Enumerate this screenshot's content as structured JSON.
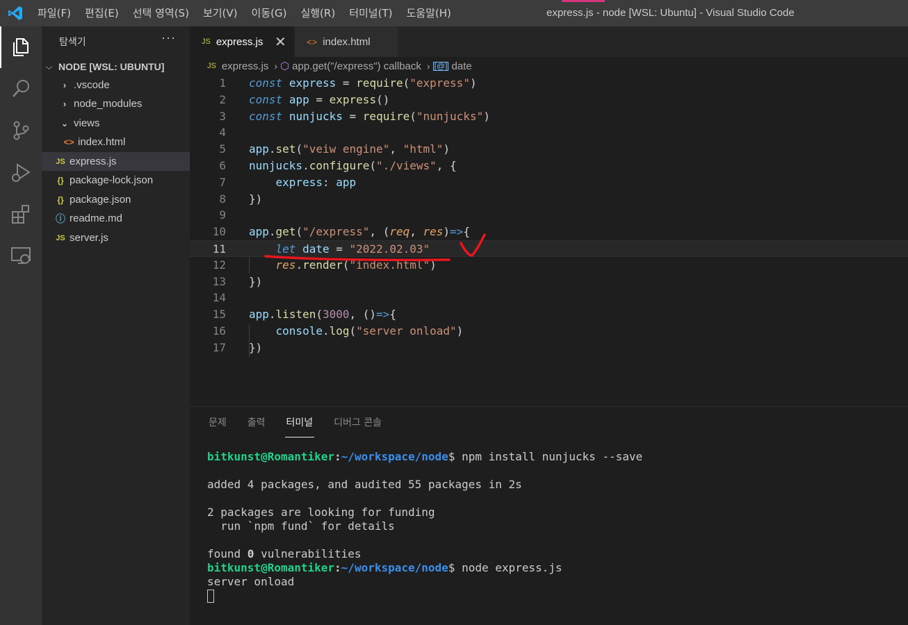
{
  "titlebar": {
    "menu": [
      "파일(F)",
      "편집(E)",
      "선택 영역(S)",
      "보기(V)",
      "이동(G)",
      "실행(R)",
      "터미널(T)",
      "도움말(H)"
    ],
    "window_title": "express.js - node [WSL: Ubuntu] - Visual Studio Code"
  },
  "activitybar": {
    "icons": [
      "explorer-icon",
      "search-icon",
      "source-control-icon",
      "run-debug-icon",
      "extensions-icon",
      "remote-explorer-icon"
    ]
  },
  "sidebar": {
    "title": "탐색기",
    "more": "···",
    "folder": "NODE [WSL: UBUNTU]",
    "items": [
      {
        "label": ".vscode",
        "icon": ">"
      },
      {
        "label": "node_modules",
        "icon": ">"
      },
      {
        "label": "views",
        "icon": "v"
      },
      {
        "label": "index.html",
        "icon": "<>"
      },
      {
        "label": "express.js",
        "icon": "JS"
      },
      {
        "label": "package-lock.json",
        "icon": "{}"
      },
      {
        "label": "package.json",
        "icon": "{}"
      },
      {
        "label": "readme.md",
        "icon": "ⓘ"
      },
      {
        "label": "server.js",
        "icon": "JS"
      }
    ]
  },
  "tabs": [
    {
      "label": "express.js",
      "icon": "JS"
    },
    {
      "label": "index.html",
      "icon": "<>"
    }
  ],
  "breadcrumb": {
    "file": "express.js",
    "symbol": "app.get(\"/express\") callback",
    "variable": "date"
  },
  "editor": {
    "line_numbers": [
      "1",
      "2",
      "3",
      "4",
      "5",
      "6",
      "7",
      "8",
      "9",
      "10",
      "11",
      "12",
      "13",
      "14",
      "15",
      "16",
      "17"
    ],
    "current_line": 11
  },
  "panel": {
    "tabs": [
      "문제",
      "출력",
      "터미널",
      "디버그 콘솔"
    ],
    "active_tab": "터미널",
    "terminal": {
      "user": "bitkunst@Romantiker",
      "path": "~/workspace/node",
      "cmd1": " npm install nunjucks --save",
      "out1": "added 4 packages, and audited 55 packages in 2s",
      "out2": "2 packages are looking for funding",
      "out3": "  run `npm fund` for details",
      "out4a": "found ",
      "out4b": "0",
      "out4c": " vulnerabilities",
      "cmd2": " node express.js",
      "out5": "server onload"
    }
  },
  "colors": {
    "activity_bar": "#333333",
    "sidebar": "#252526",
    "editor": "#1e1e1e",
    "annotation_red": "#e8161f"
  }
}
